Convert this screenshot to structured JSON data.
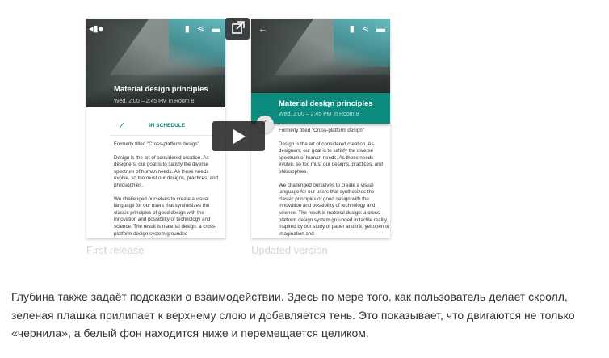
{
  "left_phone": {
    "title": "Material design principles",
    "subtitle": "Wed, 2:00 – 2:45 PM in Room 8",
    "schedule_label": "IN SCHEDULE",
    "paragraphs": [
      "Formerly titled \"Cross-platform design\"",
      "Design is the art of considered creation. As designers, our goal is to satisfy the diverse spectrum of human needs. As those needs evolve, so too must our designs, practices, and philosophies.",
      "We challenged ourselves to create a visual language for our users that synthesizes the classic principles of good design with the innovation and possibility of technology and science. The result is material design: a cross-platform design system grounded"
    ]
  },
  "right_phone": {
    "title": "Material design principles",
    "subtitle": "Wed, 2:00 – 2:45 PM in Room 8",
    "accent_color": "#0c8c7e",
    "paragraphs": [
      "Formerly titled \"Cross-platform design\"",
      "Design is the art of considered creation. As designers, our goal is to satisfy the diverse spectrum of human needs. As those needs evolve, so too must our designs, practices, and philosophies.",
      "We challenged ourselves to create a visual language for our users that synthesizes the classic principles of good design with the innovation and possibility of technology and science. The result is material design: a cross-platform design system grounded in tactile reality, inspired by our study of paper and ink, yet open to imagination and"
    ]
  },
  "captions": {
    "left": "First release",
    "right": "Updated version"
  },
  "icons": [
    "back-icon",
    "bookmark-icon",
    "share-icon",
    "comment-icon",
    "check-icon",
    "play-icon",
    "external-link-icon"
  ],
  "article_text": "Глубина также задаёт подсказки о взаимодействии. Здесь по мере того, как пользователь делает скролл, зеленая плашка прилипает к верхнему слою и добавляется тень. Это показывает, что двигаются не только «чернила», а белый фон находится ниже и перемещается целиком."
}
